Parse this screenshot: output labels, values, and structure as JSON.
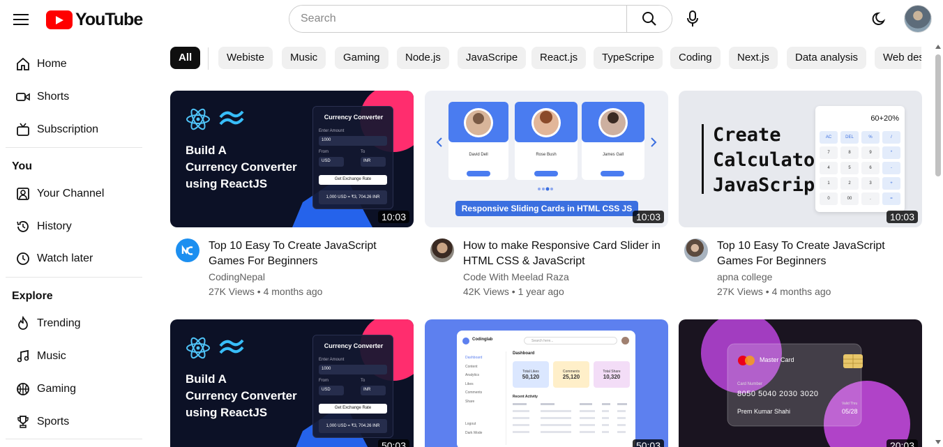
{
  "header": {
    "logo_text": "YouTube",
    "search_placeholder": "Search"
  },
  "sidebar": {
    "main": [
      {
        "label": "Home"
      },
      {
        "label": "Shorts"
      },
      {
        "label": "Subscription"
      }
    ],
    "you_heading": "You",
    "you": [
      {
        "label": "Your Channel"
      },
      {
        "label": "History"
      },
      {
        "label": "Watch later"
      }
    ],
    "explore_heading": "Explore",
    "explore": [
      {
        "label": "Trending"
      },
      {
        "label": "Music"
      },
      {
        "label": "Gaming"
      },
      {
        "label": "Sports"
      }
    ]
  },
  "chips": [
    "All",
    "Webiste",
    "Music",
    "Gaming",
    "Node.js",
    "JavaScripe",
    "React.js",
    "TypeScripe",
    "Coding",
    "Next.js",
    "Data analysis",
    "Web des"
  ],
  "videos": [
    {
      "title": "Top 10 Easy To Create JavaScript Games For Beginners",
      "channel": "CodingNepal",
      "stats": "27K Views • 4 months ago",
      "duration": "10:03",
      "thumb": {
        "line1": "Build A",
        "line2": "Currency Converter",
        "line3": "using ReactJS",
        "panel_title": "Currency Converter",
        "amount_label": "Enter Amount",
        "amount": "1000",
        "from_label": "From",
        "to_label": "To",
        "from": "USD",
        "to": "INR",
        "button": "Get Exchange Rate",
        "result": "1,000 USD = ₹3, 704.26 INR"
      }
    },
    {
      "title": "How to make Responsive Card Slider in HTML CSS & JavaScript",
      "channel": "Code With Meelad Raza",
      "stats": "42K Views • 1 year ago",
      "duration": "10:03",
      "thumb": {
        "names": [
          "David Dell",
          "Rose Bush",
          "James Gall"
        ],
        "button": "View More",
        "banner": "Responsive Sliding Cards in HTML CSS JS"
      }
    },
    {
      "title": "Top 10 Easy To Create JavaScript Games For Beginners",
      "channel": "apna college",
      "stats": "27K Views • 4 months ago",
      "duration": "10:03",
      "thumb": {
        "line1": "Create",
        "line2": "Calculator",
        "line3": "JavaScript",
        "display": "60+20%",
        "keys": [
          "AC",
          "DEL",
          "%",
          "/",
          "7",
          "8",
          "9",
          "*",
          "4",
          "5",
          "6",
          "-",
          "1",
          "2",
          "3",
          "+",
          "0",
          "00",
          ".",
          "="
        ]
      }
    },
    {
      "title": "",
      "channel": "",
      "stats": "",
      "duration": "50:03",
      "thumb": {
        "line1": "Build A",
        "line2": "Currency Converter",
        "line3": "using ReactJS",
        "panel_title": "Currency Converter",
        "amount_label": "Enter Amount",
        "amount": "1000",
        "from_label": "From",
        "to_label": "To",
        "from": "USD",
        "to": "INR",
        "button": "Get Exchange Rate",
        "result": "1,000 USD = ₹3, 704.26 INR"
      }
    },
    {
      "title": "",
      "channel": "",
      "stats": "",
      "duration": "50:03",
      "thumb": {
        "brand": "Codinglab",
        "search": "Search here...",
        "heading": "Dashboard",
        "stat1_label": "Total Likes",
        "stat1": "50,120",
        "stat2_label": "Comments",
        "stat2": "25,120",
        "stat3_label": "Total Share",
        "stat3": "10,320",
        "recent": "Recent Activity",
        "nav": [
          "Dashboard",
          "Content",
          "Analytics",
          "Likes",
          "Comments",
          "Share",
          "Logout",
          "Dark Mode"
        ]
      }
    },
    {
      "title": "",
      "channel": "",
      "stats": "",
      "duration": "20:03",
      "thumb": {
        "brand": "Master Card",
        "number_label": "Card Number",
        "number": "8050 5040 2030 3020",
        "name": "Prem Kumar Shahi",
        "valid_label": "Valid Thru",
        "valid": "05/28"
      }
    }
  ],
  "colors": {
    "brand_red": "#ff0000",
    "chip_bg": "#f0f0f0",
    "chip_active": "#0f0f0f",
    "secondary_text": "#606060"
  }
}
